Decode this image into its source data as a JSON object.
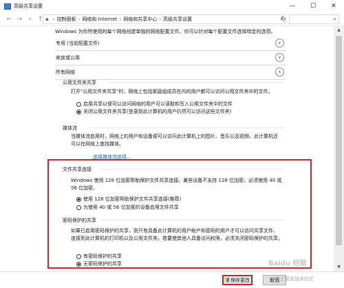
{
  "window": {
    "title": "高级共享设置",
    "minimize": "—",
    "maximize": "☐",
    "close": "✕"
  },
  "address": {
    "back": "←",
    "forward": "→",
    "up": "↑",
    "dropdown": "∨",
    "crumbs": [
      "控制面板",
      "网络和 Internet",
      "网络和共享中心",
      "高级共享设置"
    ],
    "sep": "›",
    "refresh": "↻"
  },
  "search": {
    "icon": "search-icon"
  },
  "intro": "Windows 为你所使用的每个网络创建单独的网络配置文件。你可以针对每个配置文件选择特定的选项。",
  "profiles": [
    {
      "label": "专用 (当前配置文件)",
      "chevron": "∨"
    },
    {
      "label": "来宾或公用",
      "chevron": "∨"
    },
    {
      "label": "所有网络",
      "chevron": "∧"
    }
  ],
  "public_folder": {
    "title": "公用文件夹共享",
    "desc": "打开\"公用文件夹共享\"时，网络上包括家庭组成员在内的用户都可以访问公用文件夹中的文件。",
    "options": [
      {
        "label": "启用共享以便可以访问网络的用户可以读取和写入公用文件夹中的文件",
        "selected": false
      },
      {
        "label": "关闭公用文件夹共享(登录到此计算机的用户仍然可以访问这些文件夹)",
        "selected": true
      }
    ]
  },
  "media": {
    "title": "媒体流",
    "desc_line1": "当媒体流启用时，网络上的用户和设备便可以访问此计算机上的图片、音乐以及视频。此计算机还",
    "desc_line2": "可以在网络上查找媒体。",
    "link": "选择媒体流选项..."
  },
  "file_sharing": {
    "title": "文件共享连接",
    "desc_line1": "Windows 使用 128 位加密帮助保护文件共享连接。某些设备不支持 128 位加密，必须使用 40 或",
    "desc_line2": "56 位加密。",
    "options": [
      {
        "label": "使用 128 位加密帮助保护文件共享连接(推荐)",
        "selected": true
      },
      {
        "label": "为使用 40 或 56 位加密的设备启用文件共享",
        "selected": false
      }
    ]
  },
  "password": {
    "title": "密码保护的共享",
    "desc_line1": "如果已启用密码保护的共享，则只有具备此计算机的用户帐户和密码的用户才可以访问共享文件、",
    "desc_line2": "连接到此计算机的打印机以及公用文件夹。若要使其他人具备访问权限，必须关闭密码保护的共享。",
    "options": [
      {
        "label": "有密码保护的共享",
        "selected": false
      },
      {
        "label": "无密码保护的共享",
        "selected": true
      }
    ]
  },
  "footer": {
    "save": "保存更改",
    "cancel": "取消"
  },
  "watermark": {
    "main": "Baidu 经验",
    "sub": "@稀土掘金技术社区"
  },
  "colors": {
    "highlight": "#c0262c",
    "link": "#1a5fb4"
  }
}
